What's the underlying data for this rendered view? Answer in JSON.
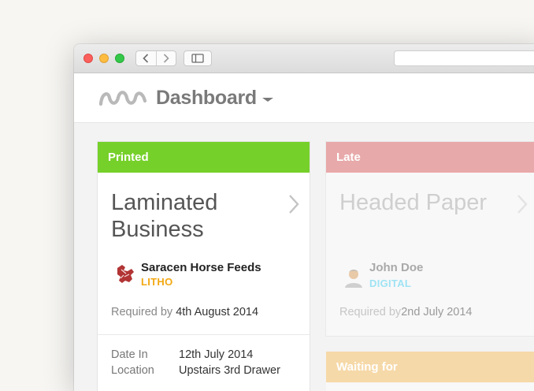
{
  "app": {
    "title": "Dashboard"
  },
  "cards": [
    {
      "status": "Printed",
      "status_color": "#76d02a",
      "title": "Laminated Business",
      "customer": "Saracen Horse Feeds",
      "method": "LITHO",
      "method_color": "#f2a813",
      "required_label": "Required by",
      "required_date": "4th August 2014",
      "details": [
        {
          "label": "Date In",
          "value": "12th July 2014"
        },
        {
          "label": "Location",
          "value": "Upstairs 3rd Drawer"
        }
      ]
    },
    {
      "status": "Late",
      "status_color": "#e8a9aa",
      "title": "Headed Paper",
      "customer": "John Doe",
      "method": "DIGITAL",
      "method_color": "#59d3ef",
      "required_label": "Required by",
      "required_date": "2nd July 2014"
    },
    {
      "status": "Waiting for",
      "status_color": "#f6d9a8"
    }
  ]
}
